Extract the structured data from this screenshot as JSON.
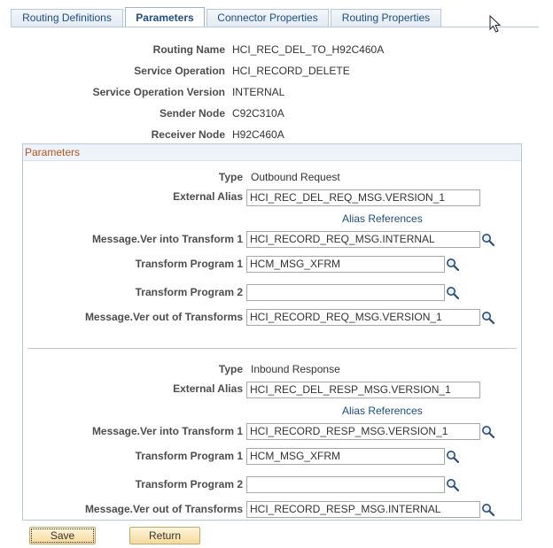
{
  "tabs": [
    {
      "label": "Routing Definitions",
      "active": false
    },
    {
      "label": "Parameters",
      "active": true
    },
    {
      "label": "Connector Properties",
      "active": false
    },
    {
      "label": "Routing Properties",
      "active": false
    }
  ],
  "header": {
    "routing_name_label": "Routing Name",
    "routing_name": "HCI_REC_DEL_TO_H92C460A",
    "service_operation_label": "Service Operation",
    "service_operation": "HCI_RECORD_DELETE",
    "service_operation_version_label": "Service Operation Version",
    "service_operation_version": "INTERNAL",
    "sender_node_label": "Sender Node",
    "sender_node": "C92C310A",
    "receiver_node_label": "Receiver Node",
    "receiver_node": "H92C460A"
  },
  "parameters": {
    "title": "Parameters",
    "labels": {
      "type": "Type",
      "external_alias": "External Alias",
      "alias_references": "Alias References",
      "msg_into": "Message.Ver into Transform 1",
      "transform1": "Transform Program 1",
      "transform2": "Transform Program 2",
      "msg_out": "Message.Ver out of Transforms"
    },
    "outbound": {
      "type": "Outbound Request",
      "external_alias": "HCI_REC_DEL_REQ_MSG.VERSION_1",
      "msg_into": "HCI_RECORD_REQ_MSG.INTERNAL",
      "transform1": "HCM_MSG_XFRM",
      "transform2": "",
      "msg_out": "HCI_RECORD_REQ_MSG.VERSION_1"
    },
    "inbound": {
      "type": "Inbound Response",
      "external_alias": "HCI_REC_DEL_RESP_MSG.VERSION_1",
      "msg_into": "HCI_RECORD_RESP_MSG.VERSION_1",
      "transform1": "HCM_MSG_XFRM",
      "transform2": "",
      "msg_out": "HCI_RECORD_RESP_MSG.INTERNAL"
    }
  },
  "buttons": {
    "save": "Save",
    "return": "Return"
  },
  "icons": {
    "lookup": "magnifier-icon",
    "cursor": "mouse-pointer-icon"
  },
  "colors": {
    "tab_text": "#1f4e82",
    "group_title": "#b5541c",
    "button_fill": "#f5d99a"
  }
}
